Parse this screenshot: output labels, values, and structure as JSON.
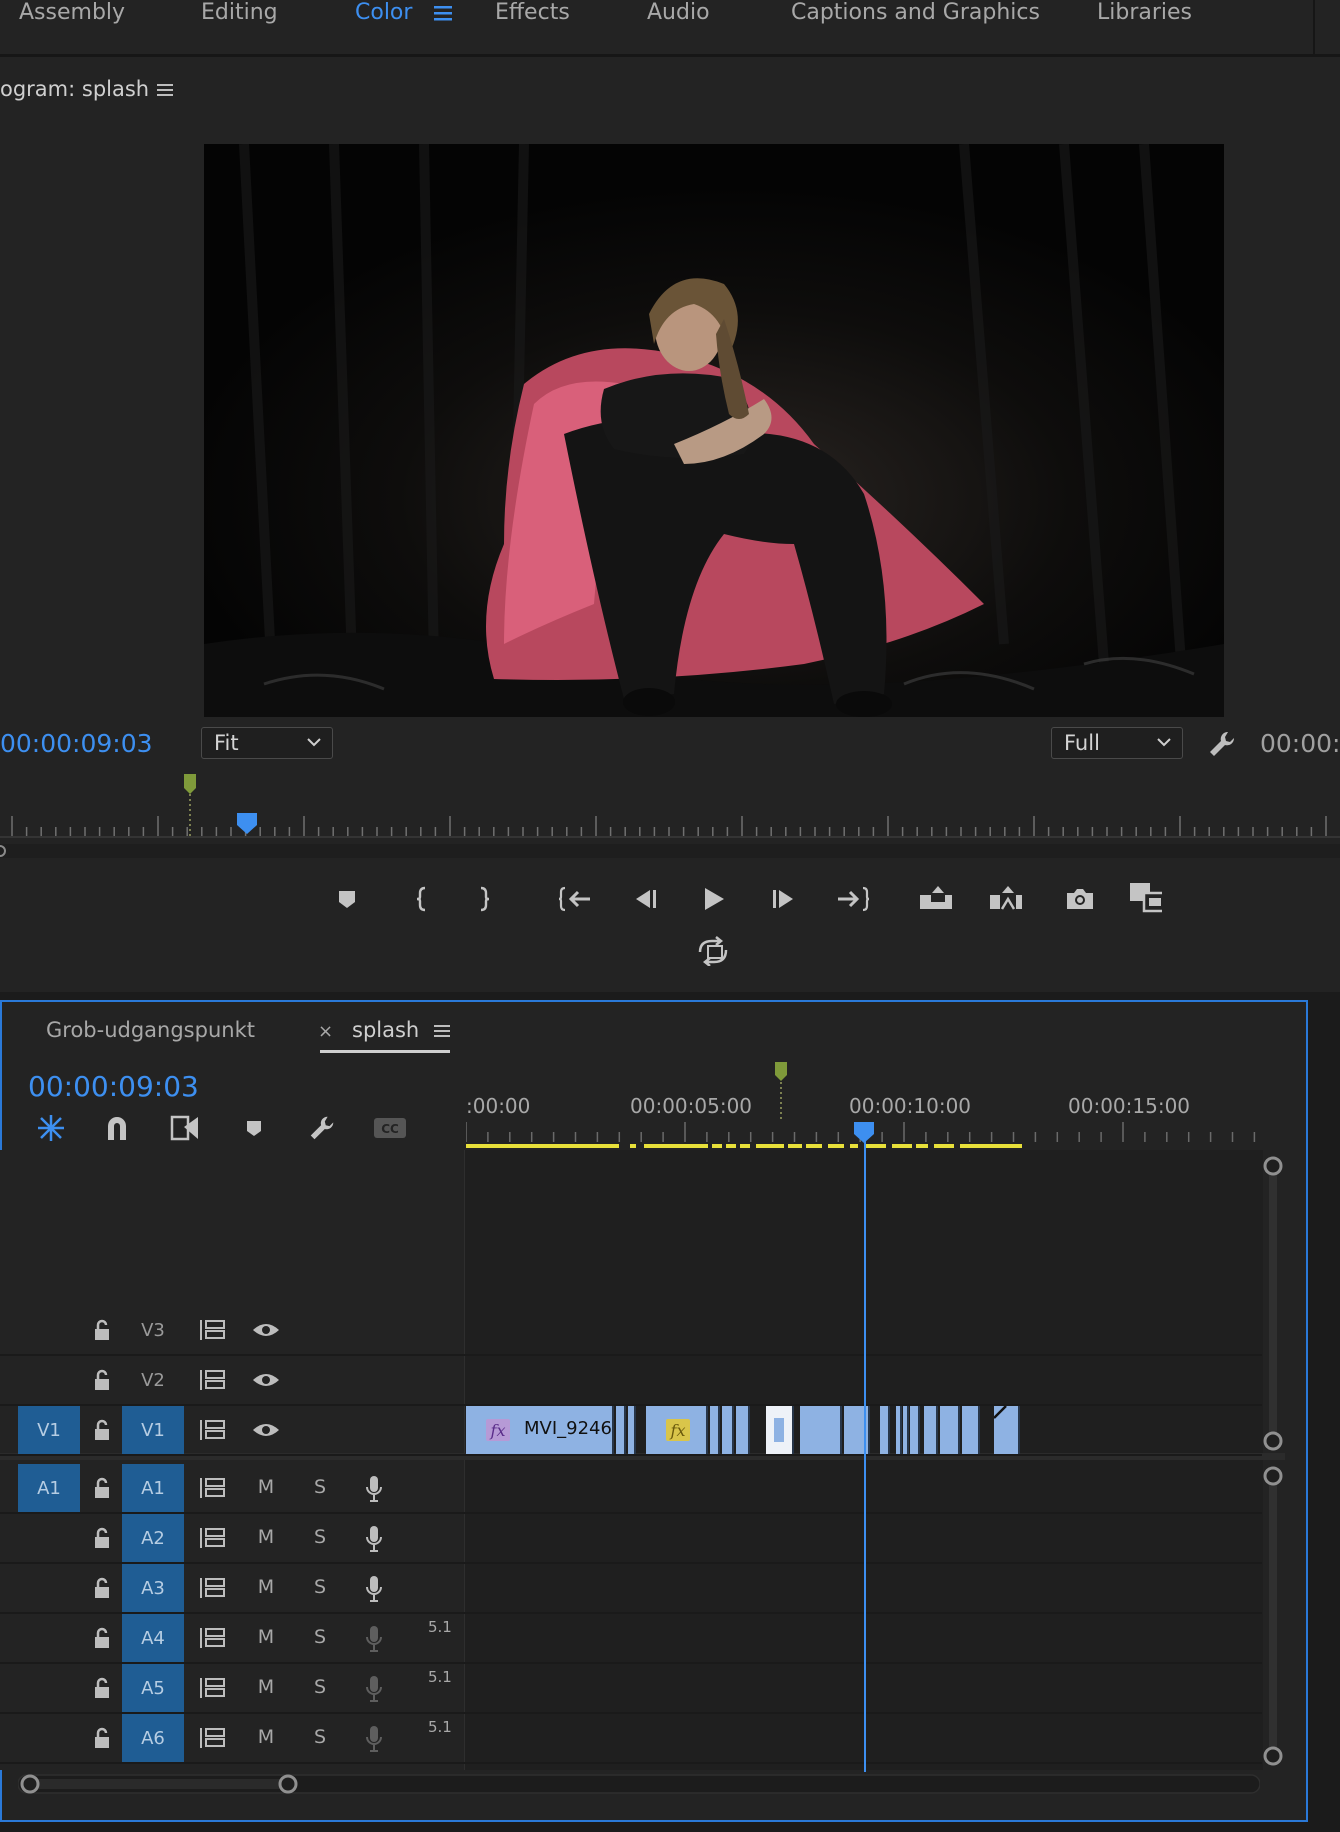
{
  "workspaces": {
    "tabs": [
      {
        "label": "Assembly",
        "active": false
      },
      {
        "label": "Editing",
        "active": false
      },
      {
        "label": "Color",
        "active": true
      },
      {
        "label": "Effects",
        "active": false
      },
      {
        "label": "Audio",
        "active": false
      },
      {
        "label": "Captions and Graphics",
        "active": false
      },
      {
        "label": "Libraries",
        "active": false
      }
    ]
  },
  "program_monitor": {
    "title": "ogram: splash",
    "playhead_timecode": "00:00:09:03",
    "zoom": "Fit",
    "resolution": "Full",
    "duration_timecode": "00:00:"
  },
  "timeline": {
    "tabs": [
      {
        "label": "Grob-udgangspunkt",
        "active": false
      },
      {
        "label": "splash",
        "active": true
      }
    ],
    "timecode": "00:00:09:03",
    "ruler": [
      ":00:00",
      "00:00:05:00",
      "00:00:10:00",
      "00:00:15:00"
    ],
    "video_tracks": [
      {
        "name": "V3",
        "source_target": ""
      },
      {
        "name": "V2",
        "source_target": ""
      },
      {
        "name": "V1",
        "source_target": "V1"
      }
    ],
    "audio_tracks": [
      {
        "name": "A1",
        "source_target": "A1",
        "mute": "M",
        "solo": "S",
        "channels": ""
      },
      {
        "name": "A2",
        "source_target": "",
        "mute": "M",
        "solo": "S",
        "channels": ""
      },
      {
        "name": "A3",
        "source_target": "",
        "mute": "M",
        "solo": "S",
        "channels": ""
      },
      {
        "name": "A4",
        "source_target": "",
        "mute": "M",
        "solo": "S",
        "channels": "5.1"
      },
      {
        "name": "A5",
        "source_target": "",
        "mute": "M",
        "solo": "S",
        "channels": "5.1"
      },
      {
        "name": "A6",
        "source_target": "",
        "mute": "M",
        "solo": "S",
        "channels": "5.1"
      }
    ],
    "clip_label": "MVI_9246",
    "fx_label": "fx"
  },
  "colors": {
    "accent": "#3d8ff0",
    "track_target": "#1f5d94",
    "clip": "#8eb2e3",
    "render_bar": "#e8e03a",
    "marker": "#7f9a3a"
  }
}
